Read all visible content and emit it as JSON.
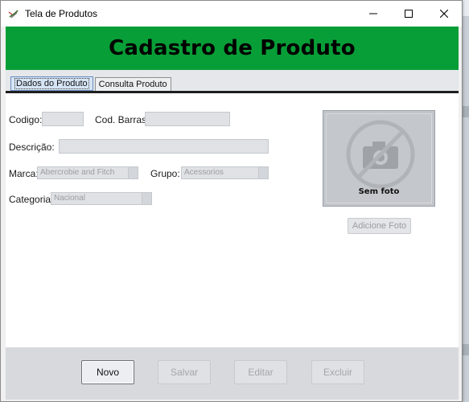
{
  "window": {
    "title": "Tela de Produtos"
  },
  "header": {
    "title": "Cadastro de Produto"
  },
  "tabs": [
    {
      "label": "Dados do Produto",
      "active": true
    },
    {
      "label": "Consulta Produto",
      "active": false
    }
  ],
  "form": {
    "codigo_label": "Codigo:",
    "codigo_value": "",
    "barras_label": "Cod. Barras:",
    "barras_value": "",
    "descricao_label": "Descrição:",
    "descricao_value": "",
    "marca_label": "Marca:",
    "marca_value": "Abercrobie and Fitch",
    "grupo_label": "Grupo:",
    "grupo_value": "Acessorios",
    "categoria_label": "Categoria:",
    "categoria_value": "Nacional"
  },
  "photo": {
    "caption": "Sem foto",
    "add_label": "Adicione Foto"
  },
  "footer": {
    "novo_label": "Novo",
    "salvar_label": "Salvar",
    "editar_label": "Editar",
    "excluir_label": "Excluir"
  },
  "colors": {
    "header_bg": "#089e37",
    "active_tab": "#d6e5f5"
  }
}
